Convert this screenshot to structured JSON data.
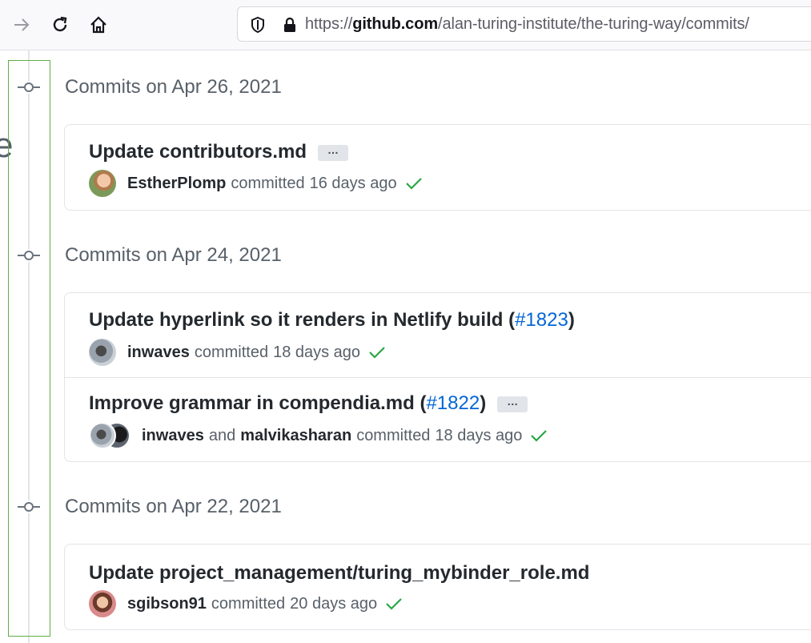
{
  "browser": {
    "url_prefix": "https://",
    "url_domain": "github.com",
    "url_path": "/alan-turing-institute/the-turing-way/commits/"
  },
  "page_fragment": "e",
  "commits_label": "committed",
  "and_label": "and",
  "groups": [
    {
      "date": "Commits on Apr 26, 2021",
      "commits": [
        {
          "title": "Update contributors.md",
          "authors": [
            "EstherPlomp"
          ],
          "time": "16 days ago",
          "has_ellipsis": true
        }
      ]
    },
    {
      "date": "Commits on Apr 24, 2021",
      "commits": [
        {
          "title": "Update hyperlink so it renders in Netlify build (",
          "pr": "#1823",
          "title_suffix": ")",
          "authors": [
            "inwaves"
          ],
          "time": "18 days ago",
          "has_ellipsis": false
        },
        {
          "title": "Improve grammar in compendia.md (",
          "pr": "#1822",
          "title_suffix": ")",
          "authors": [
            "inwaves",
            "malvikasharan"
          ],
          "time": "18 days ago",
          "has_ellipsis": true
        }
      ]
    },
    {
      "date": "Commits on Apr 22, 2021",
      "commits": [
        {
          "title": "Update project_management/turing_mybinder_role.md",
          "authors": [
            "sgibson91"
          ],
          "time": "20 days ago",
          "has_ellipsis": false
        }
      ]
    }
  ],
  "ellipsis_label": "…",
  "colors": {
    "link": "#0366d6",
    "check": "#28a745",
    "highlight": "#5fad45",
    "text_muted": "#586069"
  },
  "icons": [
    "forward-arrow-icon",
    "reload-icon",
    "home-icon",
    "shield-icon",
    "lock-icon",
    "git-commit-icon",
    "check-icon"
  ]
}
